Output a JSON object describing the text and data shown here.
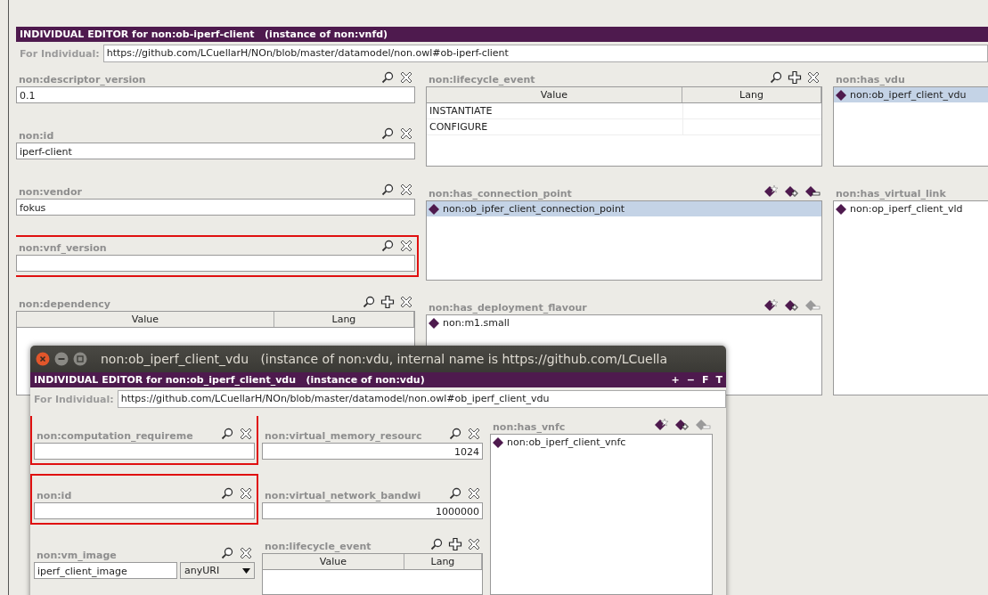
{
  "editor": {
    "title": "INDIVIDUAL EDITOR for non:ob-iperf-client   (instance of non:vnfd)",
    "for_label": "For Individual:",
    "iri": "https://github.com/LCuellarH/NOn/blob/master/datamodel/non.owl#ob-iperf-client",
    "columns": [
      {
        "sections": [
          {
            "kind": "field",
            "label": "non:descriptor_version",
            "value": "0.1",
            "highlighted": false
          },
          {
            "kind": "field",
            "label": "non:id",
            "value": "iperf-client",
            "highlighted": false
          },
          {
            "kind": "field",
            "label": "non:vendor",
            "value": "fokus",
            "highlighted": false
          },
          {
            "kind": "field",
            "label": "non:vnf_version",
            "highlighted": true
          },
          {
            "kind": "table",
            "label": "non:dependency",
            "headers": [
              "Value",
              "Lang"
            ]
          }
        ]
      },
      {
        "sections": [
          {
            "kind": "table",
            "label": "non:lifecycle_event",
            "headers": [
              "Value",
              "Lang"
            ],
            "rows": [
              "INSTANTIATE",
              "CONFIGURE"
            ]
          },
          {
            "kind": "list",
            "label": "non:has_connection_point",
            "can_remove": true,
            "items": [
              {
                "text": "non:ob_ipfer_client_connection_point",
                "selected": true
              }
            ]
          },
          {
            "kind": "list",
            "label": "non:has_deployment_flavour",
            "can_remove": false,
            "items": [
              {
                "text": "non:m1.small",
                "selected": false
              }
            ]
          }
        ]
      },
      {
        "sections": [
          {
            "kind": "list",
            "label": "non:has_vdu",
            "items": [
              {
                "text": "non:ob_iperf_client_vdu",
                "selected": true
              }
            ]
          },
          {
            "kind": "list",
            "label": "non:has_virtual_link",
            "items": [
              {
                "text": "non:op_iperf_client_vld",
                "selected": false
              }
            ]
          }
        ]
      }
    ]
  },
  "dialog": {
    "window_title": "non:ob_iperf_client_vdu   (instance of non:vdu, internal name is https://github.com/LCuella",
    "title": "INDIVIDUAL EDITOR for non:ob_iperf_client_vdu   (instance of non:vdu)",
    "bar_buttons": [
      "+",
      "−",
      "F",
      "T"
    ],
    "for_label": "For Individual:",
    "iri": "https://github.com/LCuellarH/NOn/blob/master/datamodel/non.owl#ob_iperf_client_vdu",
    "columns": [
      {
        "sections": [
          {
            "kind": "field",
            "label": "non:computation_requireme",
            "highlighted": true
          },
          {
            "kind": "field",
            "label": "non:id",
            "highlighted": true
          },
          {
            "kind": "typed_field",
            "label": "non:vm_image",
            "value": "iperf_client_image",
            "datatype": "anyURI",
            "highlighted": false
          }
        ]
      },
      {
        "sections": [
          {
            "kind": "field",
            "label": "non:virtual_memory_resourc",
            "value": "1024",
            "numeric": true,
            "highlighted": false
          },
          {
            "kind": "field",
            "label": "non:virtual_network_bandwi",
            "value": "1000000",
            "numeric": true,
            "highlighted": false
          },
          {
            "kind": "table",
            "label": "non:lifecycle_event",
            "headers": [
              "Value",
              "Lang"
            ]
          }
        ]
      },
      {
        "sections": [
          {
            "kind": "list",
            "label": "non:has_vnfc",
            "can_remove": false,
            "items": [
              {
                "text": "non:ob_iperf_client_vnfc",
                "selected": false
              }
            ]
          }
        ]
      }
    ]
  }
}
